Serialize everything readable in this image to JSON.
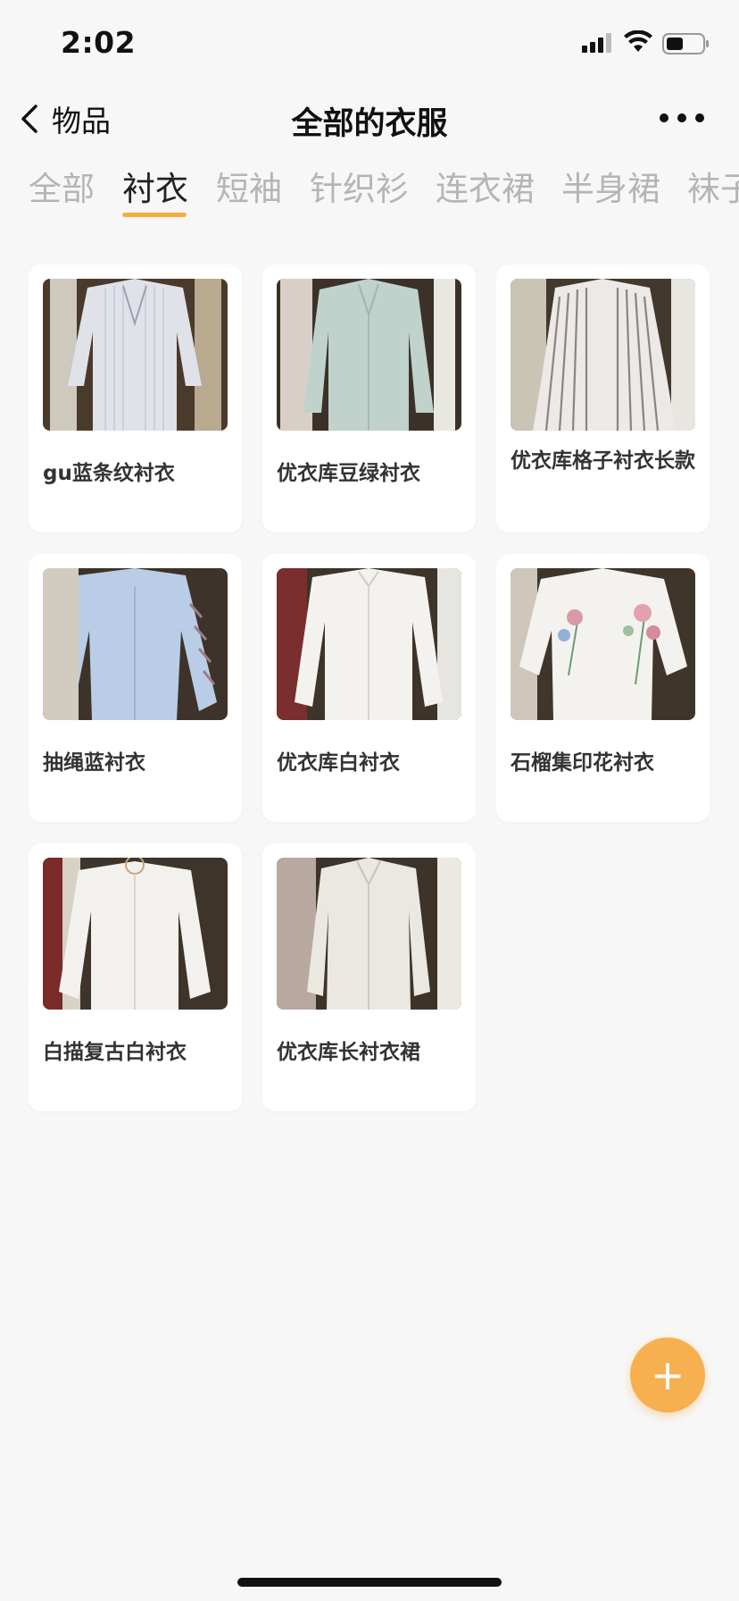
{
  "status_bar": {
    "time": "2:02",
    "signal_icon": "signal-icon",
    "wifi_icon": "wifi-icon",
    "battery_icon": "battery-icon"
  },
  "nav": {
    "back_label": "物品",
    "title": "全部的衣服",
    "back_icon": "chevron-left-icon",
    "more_icon": "more-horizontal-icon"
  },
  "tabs": [
    {
      "label": "全部",
      "active": false
    },
    {
      "label": "衬衣",
      "active": true
    },
    {
      "label": "短袖",
      "active": false
    },
    {
      "label": "针织衫",
      "active": false
    },
    {
      "label": "连衣裙",
      "active": false
    },
    {
      "label": "半身裙",
      "active": false
    },
    {
      "label": "袜子",
      "active": false
    }
  ],
  "items": [
    {
      "name": "gu蓝条纹衬衣",
      "image": "striped shirt photo"
    },
    {
      "name": "优衣库豆绿衬衣",
      "image": "green shirt photo"
    },
    {
      "name": "优衣库格子衬衣长款",
      "image": "long striped shirt photo"
    },
    {
      "name": "抽绳蓝衬衣",
      "image": "light blue shirt photo"
    },
    {
      "name": "优衣库白衬衣",
      "image": "white shirt photo"
    },
    {
      "name": "石榴集印花衬衣",
      "image": "embroidered shirt photo"
    },
    {
      "name": "白描复古白衬衣",
      "image": "vintage white shirt photo"
    },
    {
      "name": "优衣库长衬衣裙",
      "image": "long shirt dress photo"
    }
  ],
  "fab": {
    "icon": "plus-icon",
    "color": "#f7b04f"
  },
  "colors": {
    "accent": "#f5ad42",
    "background": "#f7f7f7"
  }
}
